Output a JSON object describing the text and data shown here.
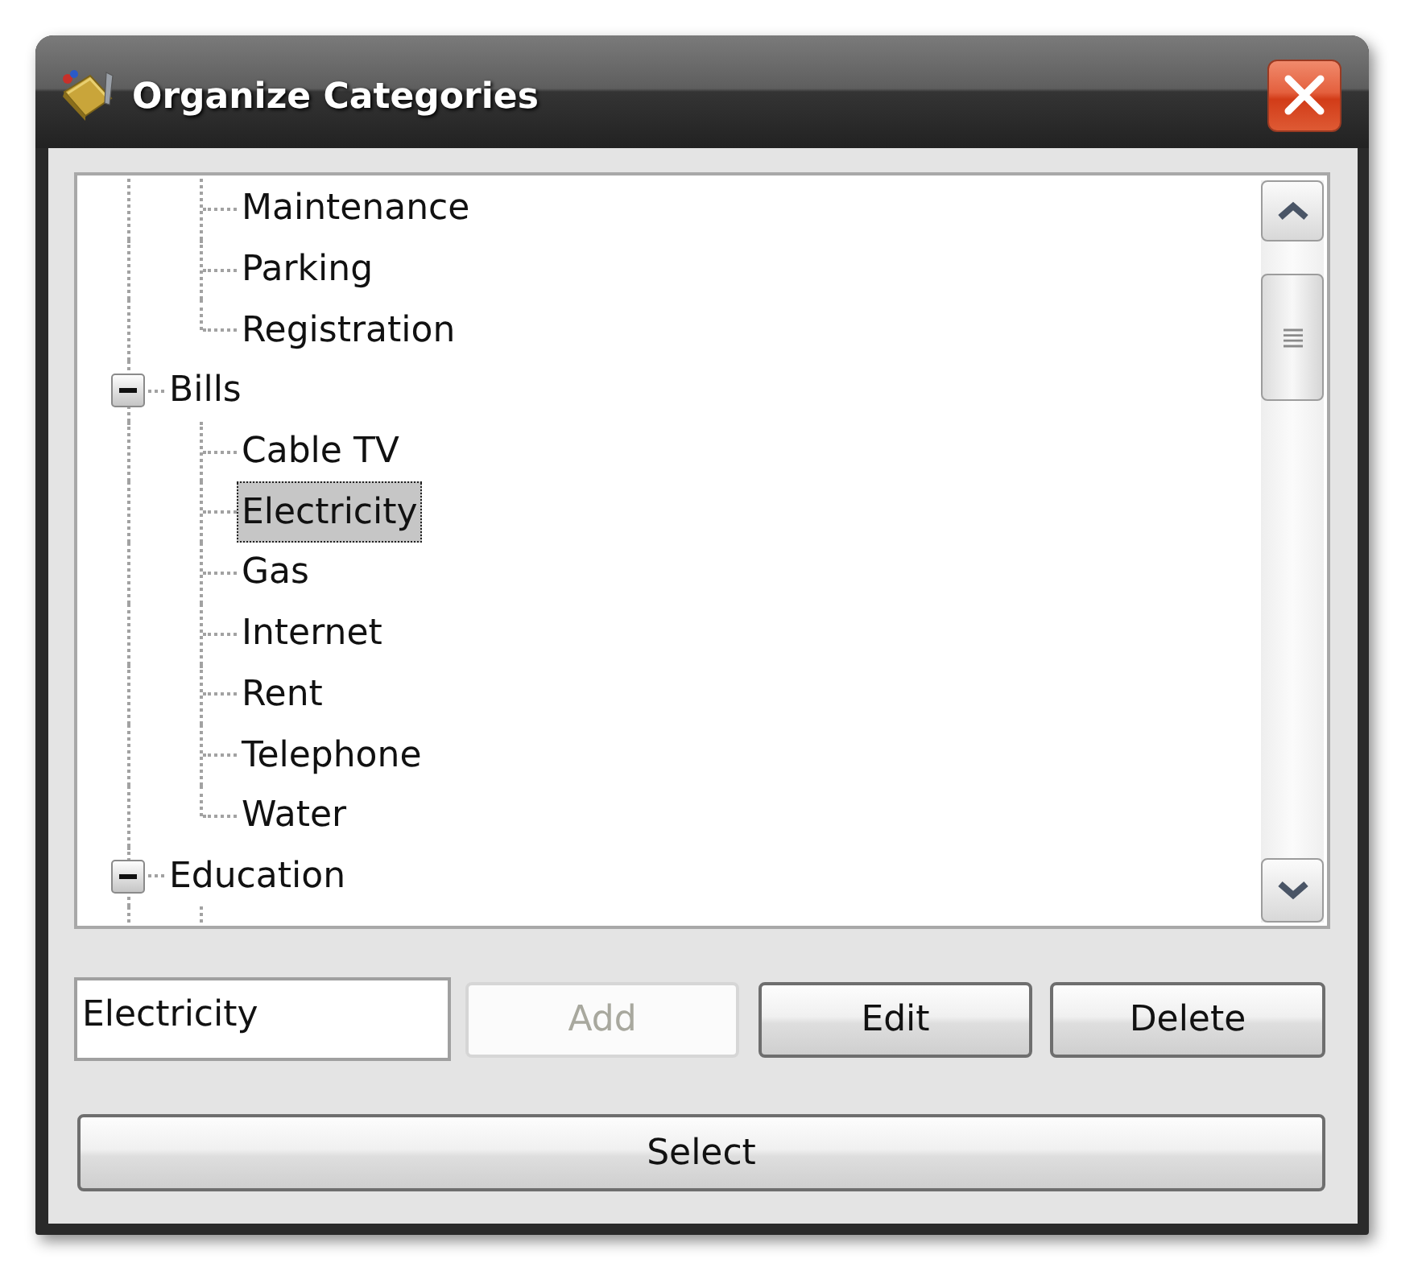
{
  "window": {
    "title": "Organize Categories"
  },
  "tree": {
    "items": [
      {
        "children": [
          {
            "label": "Maintenance",
            "selected": false
          },
          {
            "label": "Parking",
            "selected": false
          },
          {
            "label": "Registration",
            "selected": false
          }
        ]
      },
      {
        "label": "Bills",
        "selected": false,
        "expanded": true,
        "children": [
          {
            "label": "Cable TV",
            "selected": false
          },
          {
            "label": "Electricity",
            "selected": true
          },
          {
            "label": "Gas",
            "selected": false
          },
          {
            "label": "Internet",
            "selected": false
          },
          {
            "label": "Rent",
            "selected": false
          },
          {
            "label": "Telephone",
            "selected": false
          },
          {
            "label": "Water",
            "selected": false
          }
        ]
      },
      {
        "label": "Education",
        "selected": false,
        "expanded": true
      }
    ]
  },
  "name_field": {
    "value": "Electricity"
  },
  "buttons": [
    {
      "label": "Add",
      "disabled": true
    },
    {
      "label": "Edit",
      "disabled": false
    },
    {
      "label": "Delete",
      "disabled": false
    }
  ],
  "select_button": {
    "label": "Select"
  }
}
